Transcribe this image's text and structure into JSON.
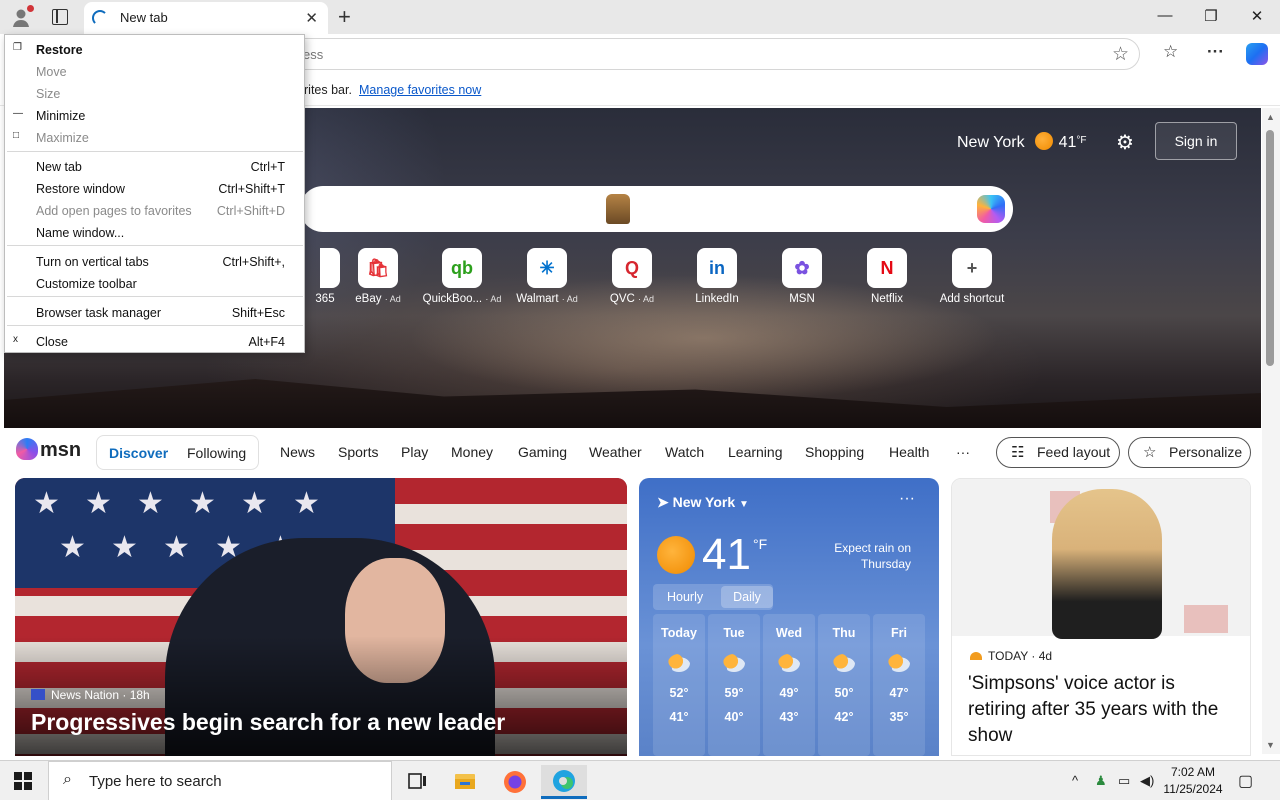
{
  "browser": {
    "tab_title": "New tab",
    "new_tab_symbol": "+",
    "close_symbol": "✕",
    "window_controls": [
      "—",
      "❐",
      "✕"
    ],
    "address_placeholder": "ess",
    "favorites_bar_text": "rites bar.",
    "favorites_bar_link": "Manage favorites now"
  },
  "context_menu": {
    "items": [
      {
        "label": "Restore",
        "shortcut": "",
        "glyph": "❐",
        "disabled": false
      },
      {
        "label": "Move",
        "shortcut": "",
        "glyph": "",
        "disabled": true
      },
      {
        "label": "Size",
        "shortcut": "",
        "glyph": "",
        "disabled": true
      },
      {
        "label": "Minimize",
        "shortcut": "",
        "glyph": "—",
        "disabled": false
      },
      {
        "label": "Maximize",
        "shortcut": "",
        "glyph": "□",
        "disabled": true
      },
      {
        "label": "New tab",
        "shortcut": "Ctrl+T",
        "glyph": "",
        "disabled": false
      },
      {
        "label": "Restore window",
        "shortcut": "Ctrl+Shift+T",
        "glyph": "",
        "disabled": false
      },
      {
        "label": "Add open pages to favorites",
        "shortcut": "Ctrl+Shift+D",
        "glyph": "",
        "disabled": true
      },
      {
        "label": "Name window...",
        "shortcut": "",
        "glyph": "",
        "disabled": false
      },
      {
        "label": "Turn on vertical tabs",
        "shortcut": "Ctrl+Shift+,",
        "glyph": "",
        "disabled": false
      },
      {
        "label": "Customize toolbar",
        "shortcut": "",
        "glyph": "",
        "disabled": false
      },
      {
        "label": "Browser task manager",
        "shortcut": "Shift+Esc",
        "glyph": "",
        "disabled": false
      },
      {
        "label": "Close",
        "shortcut": "Alt+F4",
        "glyph": "x",
        "disabled": false
      }
    ]
  },
  "hero": {
    "city": "New York",
    "temp": "41",
    "unit": "°F",
    "sign_in": "Sign in"
  },
  "shortcuts": [
    {
      "label": "365",
      "ad": "",
      "glyph": "",
      "color": "#ffffff"
    },
    {
      "label": "eBay",
      "ad": "· Ad",
      "glyph": "🛍",
      "color": "#e53238"
    },
    {
      "label": "QuickBoo...",
      "ad": "· Ad",
      "glyph": "qb",
      "color": "#2ca01c"
    },
    {
      "label": "Walmart",
      "ad": "· Ad",
      "glyph": "✳",
      "color": "#0071ce"
    },
    {
      "label": "QVC",
      "ad": "· Ad",
      "glyph": "Q",
      "color": "#d6262f"
    },
    {
      "label": "LinkedIn",
      "ad": "",
      "glyph": "in",
      "color": "#0a66c2"
    },
    {
      "label": "MSN",
      "ad": "",
      "glyph": "✿",
      "color": "#7a52e0"
    },
    {
      "label": "Netflix",
      "ad": "",
      "glyph": "N",
      "color": "#e50914"
    },
    {
      "label": "Add shortcut",
      "ad": "",
      "glyph": "+",
      "color": "#555555"
    }
  ],
  "msn": {
    "logo": "msn",
    "discover": "Discover",
    "following": "Following",
    "nav": [
      "News",
      "Sports",
      "Play",
      "Money",
      "Gaming",
      "Weather",
      "Watch",
      "Learning",
      "Shopping",
      "Health",
      "···"
    ],
    "feed_layout": "Feed layout",
    "personalize": "Personalize"
  },
  "big_card": {
    "source": "News Nation",
    "age": "· 18h",
    "headline": "Progressives begin search for a new leader"
  },
  "weather_card": {
    "location": "New York",
    "temp": "41",
    "unit": "°F",
    "rain_text": "Expect rain on Thursday",
    "tab_hourly": "Hourly",
    "tab_daily": "Daily",
    "days": [
      {
        "name": "Today",
        "hi": "52°",
        "lo": "41°"
      },
      {
        "name": "Tue",
        "hi": "59°",
        "lo": "40°"
      },
      {
        "name": "Wed",
        "hi": "49°",
        "lo": "43°"
      },
      {
        "name": "Thu",
        "hi": "50°",
        "lo": "42°"
      },
      {
        "name": "Fri",
        "hi": "47°",
        "lo": "35°"
      }
    ]
  },
  "news_card": {
    "source": "TODAY",
    "age": "· 4d",
    "headline": "'Simpsons' voice actor is retiring after 35 years with the show"
  },
  "taskbar": {
    "search_placeholder": "Type here to search",
    "time": "7:02 AM",
    "date": "11/25/2024"
  }
}
